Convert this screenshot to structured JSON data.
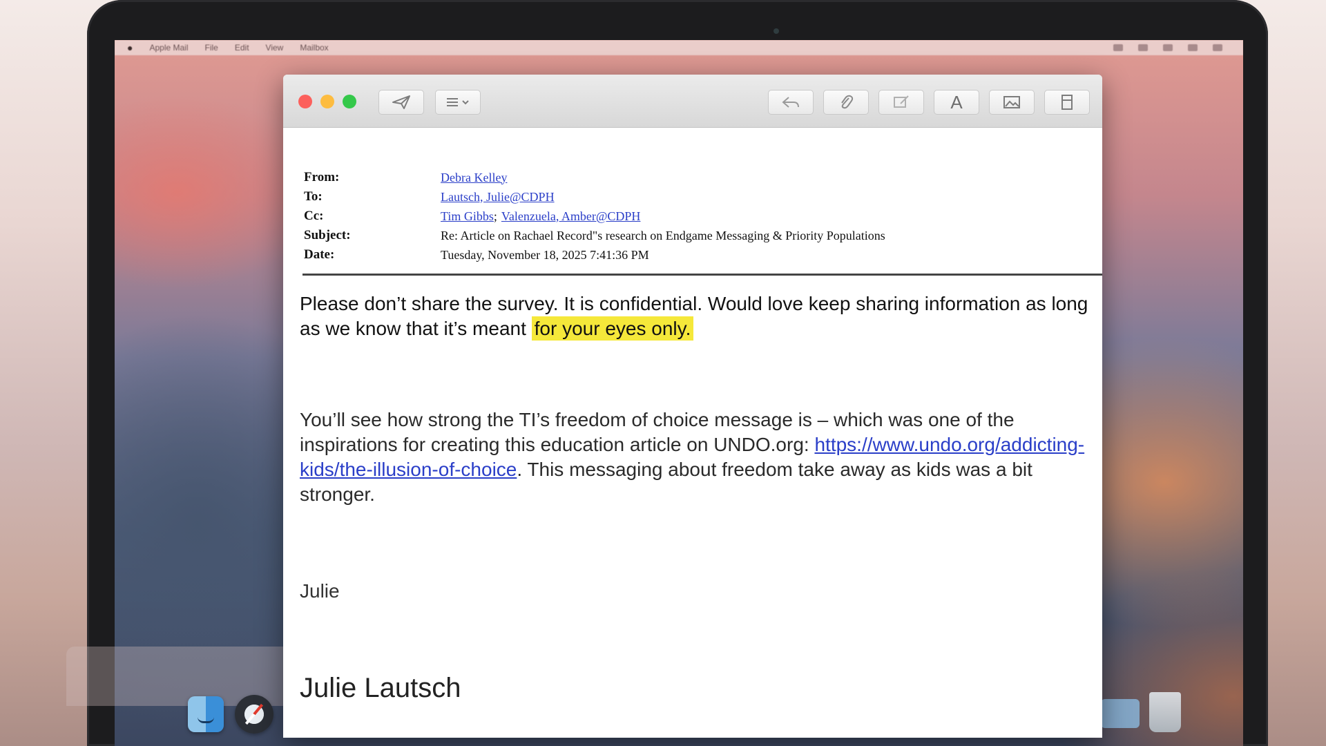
{
  "menubar": {
    "items": [
      "Apple Mail",
      "File",
      "Edit",
      "View",
      "Mailbox"
    ]
  },
  "toolbar": {
    "send_icon": "paper-plane-icon",
    "header_menu_icon": "list-chevron-icon",
    "right_icons": [
      "reply-icon",
      "paperclip-icon",
      "compose-icon",
      "font-icon",
      "photo-icon",
      "sidebar-icon"
    ]
  },
  "email": {
    "from_label": "From:",
    "from_value": "Debra Kelley",
    "to_label": "To:",
    "to_value": "Lautsch, Julie@CDPH",
    "cc_label": "Cc:",
    "cc_value_1": "Tim Gibbs",
    "cc_sep": ";",
    "cc_value_2": "Valenzuela, Amber@CDPH",
    "subject_label": "Subject:",
    "subject_value": "Re: Article on Rachael Record\"s research on Endgame Messaging & Priority Populations",
    "date_label": "Date:",
    "date_value": "Tuesday, November 18, 2025 7:41:36 PM",
    "para1_text": "Please don’t share the survey. It is confidential. Would love keep sharing information as long as we know that it’s meant ",
    "para1_highlight": "for your eyes only.",
    "para2_text": "You’ll see how strong the TI’s freedom of choice message is – which was one of the inspirations for creating this education article on UNDO.org: ",
    "para2_link": "https://www.undo.org/addicting-kids/the-illusion-of-choice",
    "para2_tail": ". This messaging about freedom take away as kids was a bit stronger.",
    "signoff": "Julie",
    "signature": "Julie Lautsch"
  },
  "colors": {
    "link": "#2a3ec8",
    "highlight": "#f5e83a",
    "close": "#fc605c",
    "minimize": "#fdbc40",
    "maximize": "#34c84a"
  }
}
